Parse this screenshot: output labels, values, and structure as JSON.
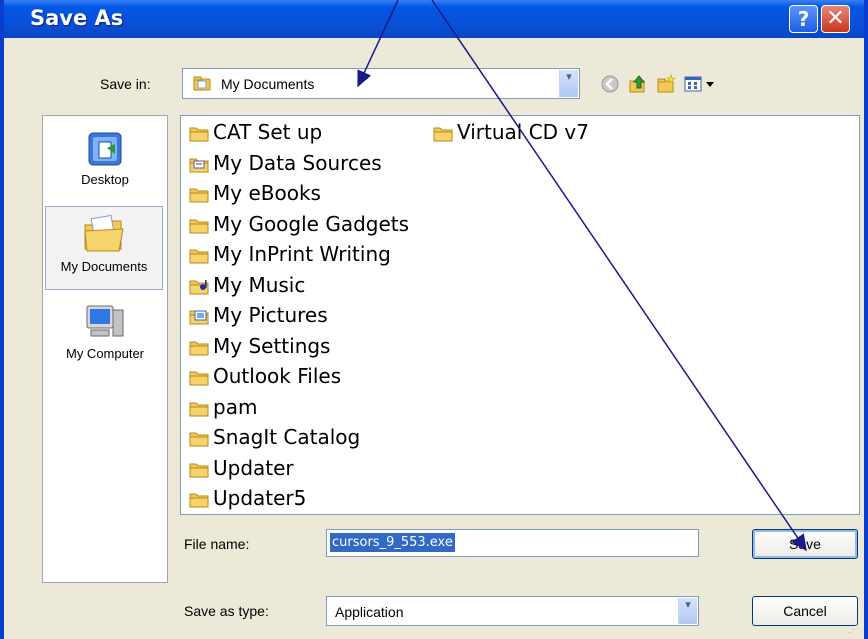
{
  "window": {
    "title": "Save As",
    "help_label": "?",
    "close_label": "✕"
  },
  "save_in": {
    "label": "Save in:",
    "value": "My Documents",
    "arrow": "▾"
  },
  "places": [
    {
      "label": "Desktop",
      "icon": "desktop-icon"
    },
    {
      "label": "My Documents",
      "icon": "my-documents-icon",
      "selected": true
    },
    {
      "label": "My Computer",
      "icon": "my-computer-icon"
    }
  ],
  "files": [
    {
      "name": "CAT Set up",
      "icon": "folder-icon"
    },
    {
      "name": "My Data Sources",
      "icon": "data-sources-folder-icon"
    },
    {
      "name": "My eBooks",
      "icon": "folder-icon"
    },
    {
      "name": "My Google Gadgets",
      "icon": "folder-icon"
    },
    {
      "name": "My InPrint Writing",
      "icon": "folder-icon"
    },
    {
      "name": "My Music",
      "icon": "music-folder-icon"
    },
    {
      "name": "My Pictures",
      "icon": "pictures-folder-icon"
    },
    {
      "name": "My Settings",
      "icon": "folder-icon"
    },
    {
      "name": "Outlook Files",
      "icon": "folder-icon"
    },
    {
      "name": "pam",
      "icon": "folder-icon"
    },
    {
      "name": "SnagIt Catalog",
      "icon": "folder-icon"
    },
    {
      "name": "Updater",
      "icon": "folder-icon"
    },
    {
      "name": "Updater5",
      "icon": "folder-icon"
    },
    {
      "name": "Virtual CD v7",
      "icon": "folder-icon"
    }
  ],
  "file_name": {
    "label": "File name:",
    "value": "cursors_9_553.exe"
  },
  "save_as_type": {
    "label": "Save as type:",
    "value": "Application",
    "arrow": "▾"
  },
  "buttons": {
    "save": "Save",
    "cancel": "Cancel"
  },
  "colors": {
    "titlebar": "#0058e6",
    "dialog_bg": "#ece9d8",
    "selection": "#316ac5",
    "arrow": "#1a1a8c",
    "folder": "#f3c955"
  }
}
